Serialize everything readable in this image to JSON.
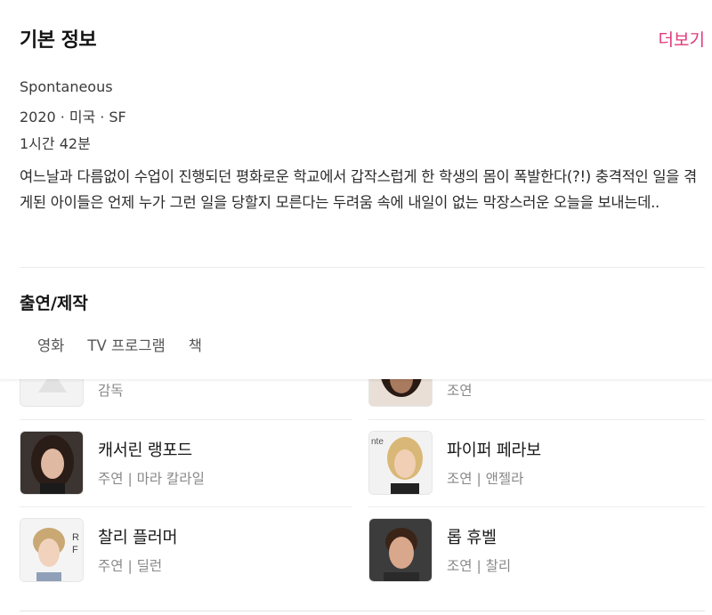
{
  "info": {
    "title": "기본 정보",
    "more": "더보기",
    "original_title": "Spontaneous",
    "year": "2020",
    "country": "미국",
    "genre": "SF",
    "separator": "·",
    "runtime": "1시간 42분",
    "synopsis": "여느날과 다름없이 수업이 진행되던 평화로운 학교에서 갑작스럽게 한 학생의 몸이 폭발한다(?!) 충격적인 일을 겪게된 아이들은 언제 누가 그런 일을 당할지 모른다는 두려움 속에 내일이 없는 막장스러운 오늘을 보내는데.."
  },
  "cast": {
    "title": "출연/제작",
    "tabs": [
      "영화",
      "TV 프로그램",
      "책"
    ],
    "people": [
      {
        "name": "",
        "role": "감독"
      },
      {
        "name": "",
        "role": "조연"
      },
      {
        "name": "캐서린 랭포드",
        "role": "주연 | 마라 칼라일"
      },
      {
        "name": "파이퍼 페라보",
        "role": "조연 | 앤젤라"
      },
      {
        "name": "찰리 플러머",
        "role": "주연 | 딜런"
      },
      {
        "name": "롭 휴벨",
        "role": "조연 | 찰리"
      }
    ]
  },
  "colors": {
    "accent": "#e0387a"
  }
}
